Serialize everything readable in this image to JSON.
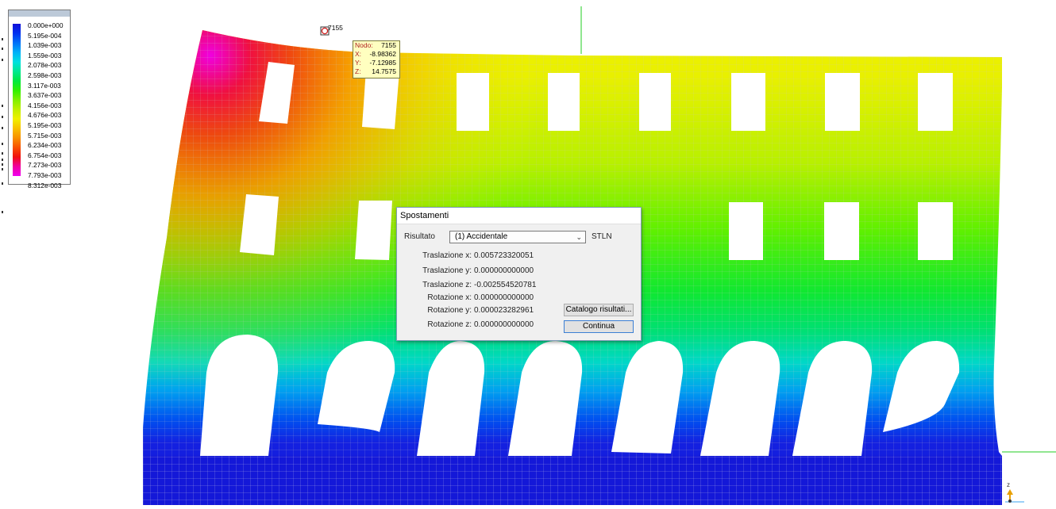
{
  "legend": {
    "values": [
      "0.000e+000",
      "5.195e-004",
      "1.039e-003",
      "1.559e-003",
      "2.078e-003",
      "2.598e-003",
      "3.117e-003",
      "3.637e-003",
      "4.156e-003",
      "4.676e-003",
      "5.195e-003",
      "5.715e-003",
      "6.234e-003",
      "6.754e-003",
      "7.273e-003",
      "7.793e-003",
      "8.312e-003"
    ],
    "colors": [
      "#1010d8",
      "#0030f0",
      "#0070f8",
      "#00b0f8",
      "#00e0e0",
      "#00e890",
      "#00e840",
      "#30f000",
      "#80f000",
      "#c0f000",
      "#f0f000",
      "#f8c000",
      "#f89000",
      "#f85000",
      "#f01010",
      "#f000a0",
      "#f000f0"
    ]
  },
  "node_tag": "7155",
  "tooltip": {
    "rows": [
      {
        "k": "Nodo:",
        "v": "7155"
      },
      {
        "k": "X:",
        "v": "-8.98362"
      },
      {
        "k": "Y:",
        "v": "-7.12985"
      },
      {
        "k": "Z:",
        "v": "14.7575"
      }
    ]
  },
  "dialog": {
    "title": "Spostamenti",
    "risultato_label": "Risultato",
    "risultato_value": "(1) Accidentale",
    "stln": "STLN",
    "results": [
      {
        "label": "Traslazione x:",
        "value": "0.005723320051"
      },
      {
        "label": "Traslazione y:",
        "value": "0.000000000000"
      },
      {
        "label": "Traslazione z:",
        "value": "-0.002554520781"
      },
      {
        "label": "Rotazione x:",
        "value": "0.000000000000"
      },
      {
        "label": "Rotazione y:",
        "value": "0.000023282961"
      },
      {
        "label": "Rotazione z:",
        "value": "0.000000000000"
      }
    ],
    "catalog_button": "Catalogo risultati...",
    "continue_button": "Continua"
  },
  "axis": {
    "z_label": "z"
  },
  "colors": {
    "selection_line": "#22cc22",
    "axis_arrow": "#e8a000"
  }
}
